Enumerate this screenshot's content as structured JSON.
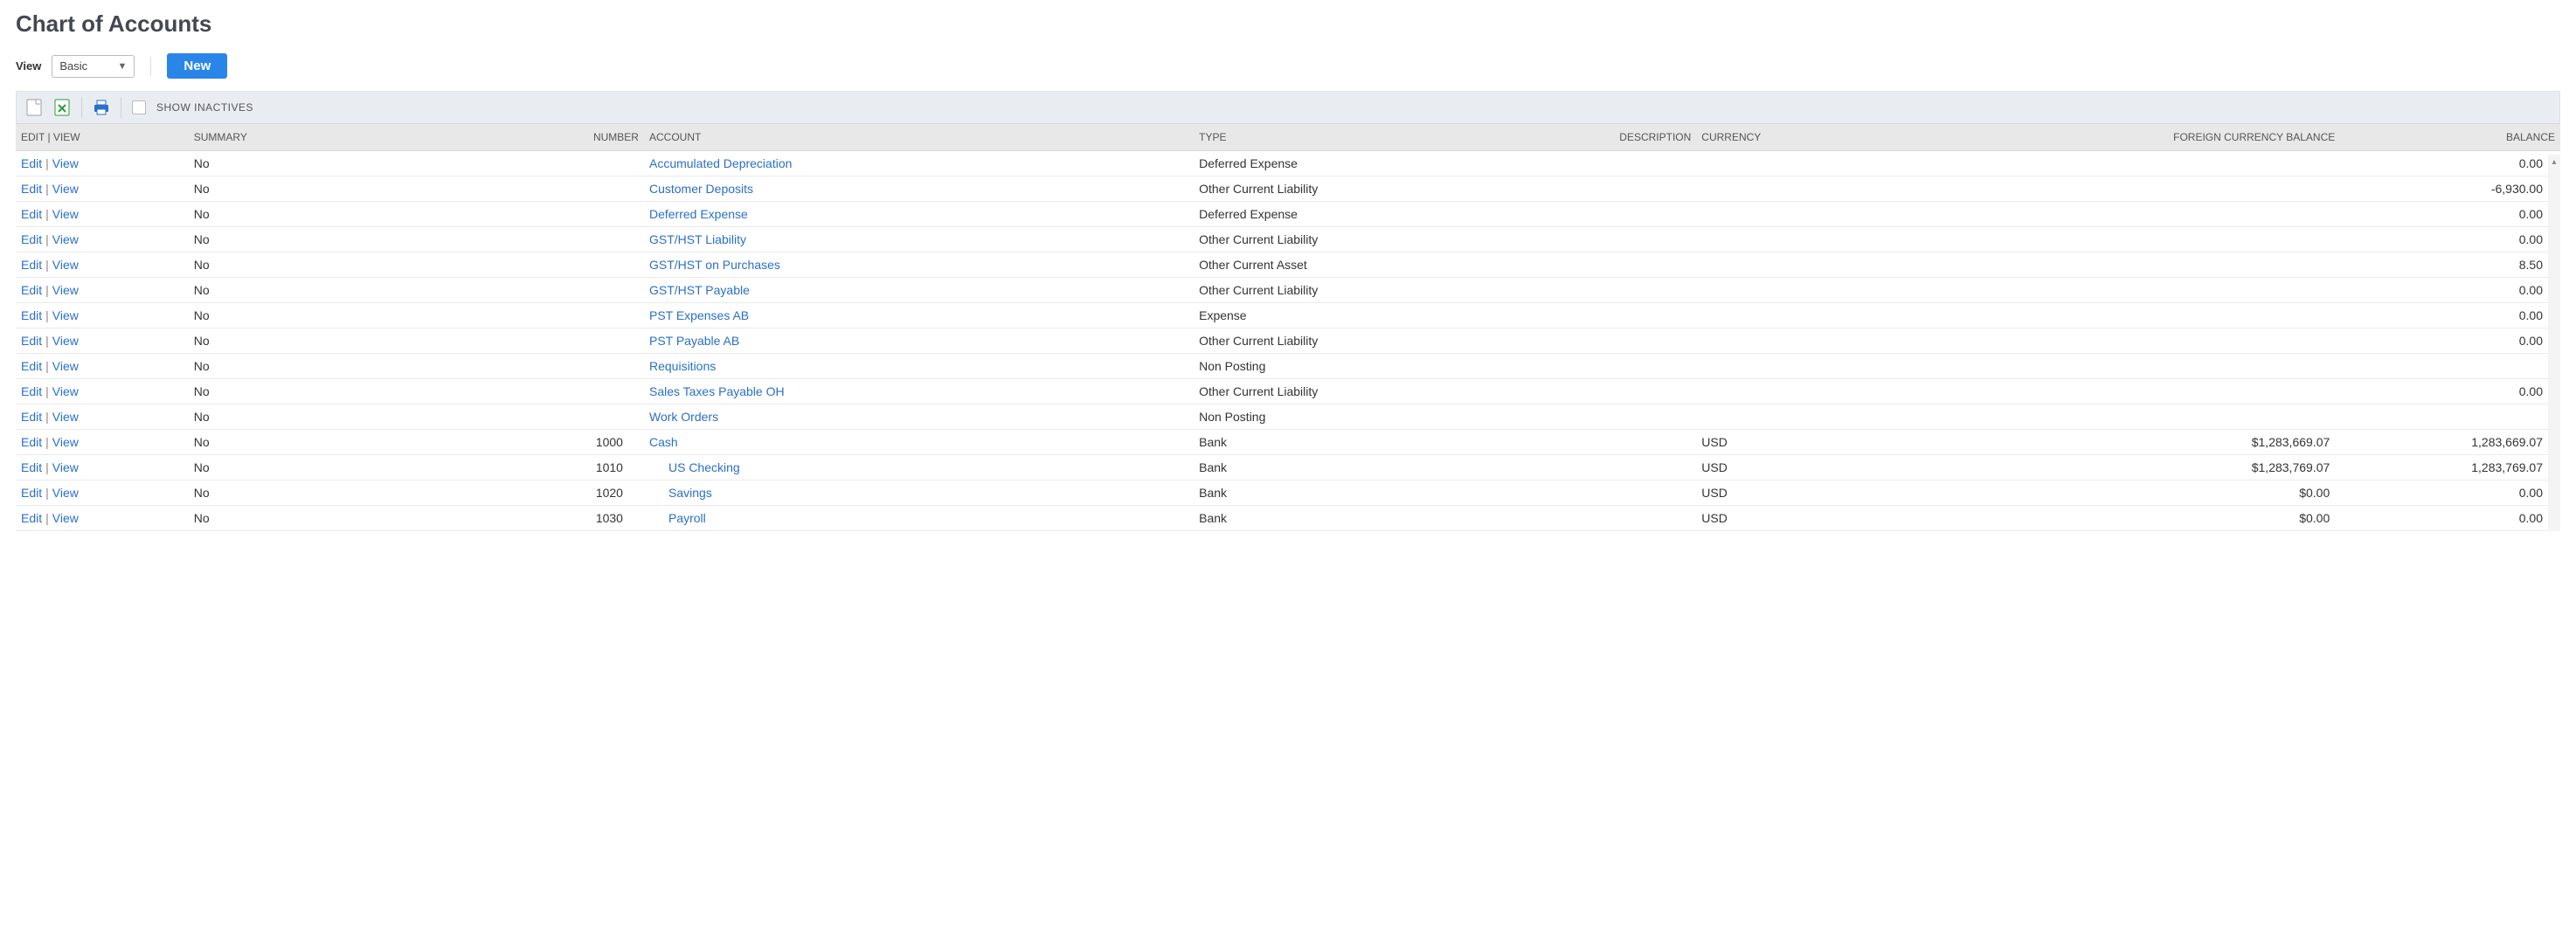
{
  "page_title": "Chart of Accounts",
  "view_label": "View",
  "view_value": "Basic",
  "new_button": "New",
  "show_inactives_label": "SHOW INACTIVES",
  "actions": {
    "edit": "Edit",
    "view": "View"
  },
  "columns": {
    "edit_view": "EDIT | VIEW",
    "summary": "SUMMARY",
    "number": "NUMBER",
    "account": "ACCOUNT",
    "type": "TYPE",
    "description": "DESCRIPTION",
    "currency": "CURRENCY",
    "fcb": "FOREIGN CURRENCY BALANCE",
    "balance": "BALANCE"
  },
  "rows": [
    {
      "summary": "No",
      "number": "",
      "account": "Accumulated Depreciation",
      "indent": 0,
      "type": "Deferred Expense",
      "description": "",
      "currency": "",
      "fcb": "",
      "balance": "0.00"
    },
    {
      "summary": "No",
      "number": "",
      "account": "Customer Deposits",
      "indent": 0,
      "type": "Other Current Liability",
      "description": "",
      "currency": "",
      "fcb": "",
      "balance": "-6,930.00"
    },
    {
      "summary": "No",
      "number": "",
      "account": "Deferred Expense",
      "indent": 0,
      "type": "Deferred Expense",
      "description": "",
      "currency": "",
      "fcb": "",
      "balance": "0.00"
    },
    {
      "summary": "No",
      "number": "",
      "account": "GST/HST Liability",
      "indent": 0,
      "type": "Other Current Liability",
      "description": "",
      "currency": "",
      "fcb": "",
      "balance": "0.00"
    },
    {
      "summary": "No",
      "number": "",
      "account": "GST/HST on Purchases",
      "indent": 0,
      "type": "Other Current Asset",
      "description": "",
      "currency": "",
      "fcb": "",
      "balance": "8.50"
    },
    {
      "summary": "No",
      "number": "",
      "account": "GST/HST Payable",
      "indent": 0,
      "type": "Other Current Liability",
      "description": "",
      "currency": "",
      "fcb": "",
      "balance": "0.00"
    },
    {
      "summary": "No",
      "number": "",
      "account": "PST Expenses AB",
      "indent": 0,
      "type": "Expense",
      "description": "",
      "currency": "",
      "fcb": "",
      "balance": "0.00"
    },
    {
      "summary": "No",
      "number": "",
      "account": "PST Payable AB",
      "indent": 0,
      "type": "Other Current Liability",
      "description": "",
      "currency": "",
      "fcb": "",
      "balance": "0.00"
    },
    {
      "summary": "No",
      "number": "",
      "account": "Requisitions",
      "indent": 0,
      "type": "Non Posting",
      "description": "",
      "currency": "",
      "fcb": "",
      "balance": ""
    },
    {
      "summary": "No",
      "number": "",
      "account": "Sales Taxes Payable OH",
      "indent": 0,
      "type": "Other Current Liability",
      "description": "",
      "currency": "",
      "fcb": "",
      "balance": "0.00"
    },
    {
      "summary": "No",
      "number": "",
      "account": "Work Orders",
      "indent": 0,
      "type": "Non Posting",
      "description": "",
      "currency": "",
      "fcb": "",
      "balance": ""
    },
    {
      "summary": "No",
      "number": "1000",
      "account": "Cash",
      "indent": 0,
      "type": "Bank",
      "description": "",
      "currency": "USD",
      "fcb": "$1,283,669.07",
      "balance": "1,283,669.07"
    },
    {
      "summary": "No",
      "number": "1010",
      "account": "US Checking",
      "indent": 1,
      "type": "Bank",
      "description": "",
      "currency": "USD",
      "fcb": "$1,283,769.07",
      "balance": "1,283,769.07"
    },
    {
      "summary": "No",
      "number": "1020",
      "account": "Savings",
      "indent": 1,
      "type": "Bank",
      "description": "",
      "currency": "USD",
      "fcb": "$0.00",
      "balance": "0.00"
    },
    {
      "summary": "No",
      "number": "1030",
      "account": "Payroll",
      "indent": 1,
      "type": "Bank",
      "description": "",
      "currency": "USD",
      "fcb": "$0.00",
      "balance": "0.00"
    }
  ]
}
